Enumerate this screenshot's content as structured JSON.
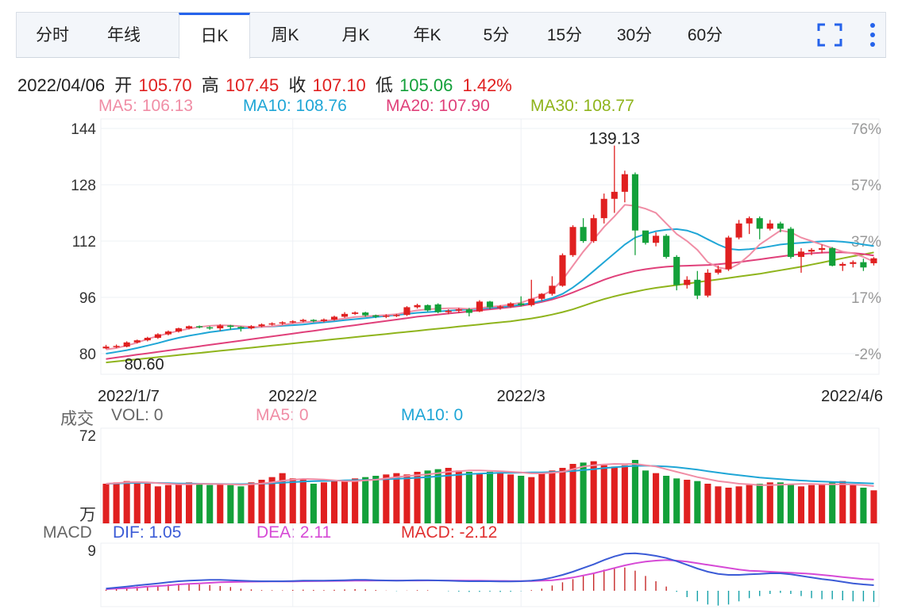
{
  "tabs": [
    {
      "label": "分时",
      "active": false
    },
    {
      "label": "年线",
      "active": false
    },
    {
      "label": "日K",
      "active": true
    },
    {
      "label": "周K",
      "active": false
    },
    {
      "label": "月K",
      "active": false
    },
    {
      "label": "年K",
      "active": false
    },
    {
      "label": "5分",
      "active": false
    },
    {
      "label": "15分",
      "active": false
    },
    {
      "label": "30分",
      "active": false
    },
    {
      "label": "60分",
      "active": false
    }
  ],
  "icons": {
    "fullscreen": "fullscreen-icon",
    "more": "more-vertical-icon"
  },
  "info": {
    "date": "2022/04/06",
    "open_label": "开",
    "open": "105.70",
    "high_label": "高",
    "high": "107.45",
    "close_label": "收",
    "close": "107.10",
    "low_label": "低",
    "low": "105.06",
    "change": "1.42%"
  },
  "ma_legend": [
    {
      "text": "MA5: 106.13",
      "color": "#f08da5"
    },
    {
      "text": "MA10: 108.76",
      "color": "#1fa6d6"
    },
    {
      "text": "MA20: 107.90",
      "color": "#e0407a"
    },
    {
      "text": "MA30: 108.77",
      "color": "#8fb41c"
    }
  ],
  "colors": {
    "up": "#e02020",
    "down": "#13a03a",
    "ma5": "#f08da5",
    "ma10": "#1fa6d6",
    "ma20": "#e0407a",
    "ma30": "#8fb41c",
    "dif": "#3b5bd6",
    "dea": "#d64ad6"
  },
  "chart_data": {
    "type": "candlestick",
    "y_ticks": [
      "144",
      "128",
      "112",
      "96",
      "80"
    ],
    "ylim": [
      80,
      144
    ],
    "pct_ticks": [
      "76%",
      "57%",
      "37%",
      "17%",
      "-2%"
    ],
    "x_ticks": [
      "2022/1/7",
      "2022/2",
      "2022/3",
      "2022/4/6"
    ],
    "max_label": "139.13",
    "min_label": "80.60",
    "candles": [
      [
        81.5,
        82,
        81.3,
        82.5
      ],
      [
        82,
        82.2,
        81.6,
        82.6
      ],
      [
        82,
        83.2,
        81.8,
        83.5
      ],
      [
        83.2,
        83.8,
        82.9,
        84
      ],
      [
        83.8,
        84.5,
        83.5,
        84.8
      ],
      [
        84.5,
        85.5,
        84.2,
        85.8
      ],
      [
        85.5,
        86.3,
        85.2,
        86.6
      ],
      [
        86.3,
        87.2,
        86,
        87.4
      ],
      [
        87.2,
        87.8,
        86.9,
        88
      ],
      [
        87.8,
        87.5,
        87.2,
        88
      ],
      [
        87.5,
        87.2,
        86.8,
        87.8
      ],
      [
        87.2,
        88,
        86.5,
        88.4
      ],
      [
        88,
        87.6,
        86.8,
        88.2
      ],
      [
        87.6,
        87.2,
        86.3,
        87.8
      ],
      [
        87.2,
        87.8,
        86.9,
        88.1
      ],
      [
        87.8,
        88.3,
        87.5,
        88.6
      ],
      [
        88.3,
        88.6,
        88,
        88.9
      ],
      [
        88.6,
        88.9,
        88.2,
        89.2
      ],
      [
        88.9,
        89.2,
        88.6,
        89.5
      ],
      [
        89.2,
        89.6,
        88.9,
        89.9
      ],
      [
        89.6,
        89.3,
        88.9,
        89.8
      ],
      [
        89.3,
        89.7,
        88.9,
        90
      ],
      [
        89.7,
        90.5,
        89.4,
        90.8
      ],
      [
        90.5,
        91.3,
        90.2,
        91.8
      ],
      [
        91.3,
        91.7,
        91,
        92
      ],
      [
        91.7,
        90.9,
        90.5,
        91.9
      ],
      [
        90.9,
        90.5,
        90.1,
        91.1
      ],
      [
        90.5,
        90.8,
        90.1,
        91.2
      ],
      [
        90.8,
        91,
        90.4,
        91.3
      ],
      [
        91,
        93.2,
        90.7,
        93.5
      ],
      [
        93.2,
        93.8,
        92.8,
        94.2
      ],
      [
        93.8,
        92.3,
        92,
        94
      ],
      [
        94,
        91.8,
        91.5,
        94.3
      ],
      [
        91.8,
        92.2,
        91.2,
        92.6
      ],
      [
        92.2,
        92.6,
        91.6,
        93
      ],
      [
        92.6,
        91.6,
        90.6,
        93
      ],
      [
        92,
        94.8,
        91.8,
        95.2
      ],
      [
        94.8,
        93.2,
        92.6,
        95
      ],
      [
        93.2,
        93.4,
        92.5,
        93.8
      ],
      [
        93.4,
        94.3,
        93,
        94.6
      ],
      [
        94.3,
        93.8,
        93.4,
        96.3
      ],
      [
        93.8,
        95.6,
        93.4,
        101
      ],
      [
        95.6,
        97,
        95,
        97.2
      ],
      [
        97,
        99.3,
        96.5,
        102
      ],
      [
        99.3,
        108,
        99,
        108.5
      ],
      [
        108,
        116,
        107.5,
        116.5
      ],
      [
        116,
        112,
        111.5,
        118.5
      ],
      [
        112,
        118.5,
        111.5,
        119.5
      ],
      [
        118.5,
        124,
        117,
        125.5
      ],
      [
        124,
        126,
        120,
        139.13
      ],
      [
        126,
        131,
        123,
        132
      ],
      [
        131,
        115,
        108,
        131.5
      ],
      [
        115,
        111.5,
        111,
        114
      ],
      [
        111.5,
        113.5,
        110.5,
        114.5
      ],
      [
        113.5,
        107.5,
        107,
        114
      ],
      [
        107.5,
        99.5,
        98,
        108
      ],
      [
        99.5,
        101,
        98.5,
        102
      ],
      [
        101,
        96.5,
        95.5,
        103.5
      ],
      [
        96.5,
        103,
        96,
        104
      ],
      [
        103,
        104,
        102.5,
        105
      ],
      [
        104,
        113,
        103.5,
        113.5
      ],
      [
        113,
        117,
        112.5,
        118
      ],
      [
        117,
        118.5,
        114,
        119
      ],
      [
        118.5,
        115.5,
        112.5,
        119
      ],
      [
        115.5,
        117,
        115,
        118
      ],
      [
        117,
        115.5,
        114.5,
        117.5
      ],
      [
        115.5,
        107.5,
        107,
        116
      ],
      [
        107.5,
        109,
        103,
        110
      ],
      [
        109,
        109.5,
        108,
        110
      ],
      [
        109.5,
        110,
        108.5,
        111
      ],
      [
        110,
        105,
        104.8,
        110.3
      ],
      [
        105,
        105.5,
        103.5,
        106
      ],
      [
        105.5,
        106,
        104.5,
        106.5
      ],
      [
        106,
        104.5,
        103.5,
        107
      ],
      [
        105.7,
        107.1,
        105.06,
        107.45
      ]
    ],
    "ma5": [
      81.2,
      81.6,
      82.3,
      83.1,
      84.2,
      85,
      85.8,
      86.5,
      87.1,
      87.6,
      87.9,
      88.1,
      88,
      87.8,
      87.6,
      87.6,
      87.8,
      88.2,
      88.6,
      88.9,
      89.1,
      89.3,
      89.6,
      90,
      90.4,
      90.6,
      90.8,
      91,
      91.2,
      91.8,
      92.3,
      92.6,
      92.8,
      92.9,
      92.9,
      92.7,
      93,
      93.3,
      93.6,
      94,
      94.5,
      95.5,
      96.5,
      98,
      101,
      105,
      109,
      112.5,
      116,
      119,
      122.3,
      122,
      121.2,
      120,
      117,
      114,
      112,
      109.5,
      106,
      104.5,
      104,
      105.5,
      108,
      111,
      113,
      115,
      114.5,
      113,
      112,
      111,
      110,
      109,
      108.5,
      107.5,
      106.13
    ],
    "ma10": [
      80,
      80.5,
      81,
      81.6,
      82.3,
      83,
      83.8,
      84.5,
      85.1,
      85.6,
      86.1,
      86.5,
      86.9,
      87.2,
      87.4,
      87.6,
      87.7,
      87.9,
      88.1,
      88.3,
      88.6,
      88.9,
      89.2,
      89.5,
      89.8,
      90.1,
      90.4,
      90.7,
      91,
      91.3,
      91.6,
      91.8,
      92,
      92.2,
      92.4,
      92.6,
      92.8,
      93,
      93.2,
      93.5,
      93.9,
      94.4,
      95,
      95.8,
      97,
      98.8,
      101,
      103.5,
      106,
      108.5,
      111,
      113,
      114,
      114.8,
      115.2,
      115.4,
      115,
      114,
      112.5,
      111,
      109.8,
      109.5,
      109.7,
      110,
      110.5,
      111,
      111.3,
      111.5,
      111.7,
      111.9,
      112,
      111.8,
      111.5,
      111,
      110.6
    ],
    "ma20": [
      78.5,
      78.9,
      79.3,
      79.7,
      80.1,
      80.5,
      80.9,
      81.3,
      81.7,
      82.1,
      82.5,
      82.9,
      83.3,
      83.7,
      84.1,
      84.5,
      84.9,
      85.3,
      85.7,
      86.1,
      86.5,
      86.9,
      87.3,
      87.7,
      88.1,
      88.5,
      88.9,
      89.3,
      89.7,
      90.1,
      90.5,
      90.8,
      91.1,
      91.4,
      91.7,
      92,
      92.3,
      92.6,
      92.9,
      93.2,
      93.6,
      94.1,
      94.7,
      95.4,
      96.3,
      97.4,
      98.6,
      99.8,
      101,
      102,
      102.8,
      103.5,
      104,
      104.4,
      104.7,
      104.9,
      105,
      105.1,
      105.2,
      105.4,
      105.7,
      106,
      106.4,
      106.8,
      107.2,
      107.6,
      108,
      108.3,
      108.5,
      108.7,
      108.8,
      108.8,
      108.6,
      108.3,
      107.9
    ],
    "ma30": [
      77.5,
      77.8,
      78.1,
      78.4,
      78.7,
      79,
      79.3,
      79.6,
      79.9,
      80.2,
      80.5,
      80.8,
      81.1,
      81.4,
      81.7,
      82,
      82.3,
      82.6,
      82.9,
      83.2,
      83.5,
      83.8,
      84.1,
      84.4,
      84.7,
      85,
      85.3,
      85.6,
      85.9,
      86.2,
      86.5,
      86.8,
      87.1,
      87.4,
      87.7,
      88,
      88.3,
      88.6,
      88.9,
      89.2,
      89.6,
      90,
      90.5,
      91.1,
      91.8,
      92.6,
      93.6,
      94.6,
      95.5,
      96.3,
      97,
      97.6,
      98.2,
      98.7,
      99.1,
      99.5,
      99.9,
      100.3,
      100.7,
      101.1,
      101.5,
      101.9,
      102.3,
      102.7,
      103.2,
      103.7,
      104.2,
      104.7,
      105.3,
      105.9,
      106.5,
      107.1,
      107.7,
      108.2,
      108.77
    ],
    "volume": {
      "legend": [
        {
          "text": "成交",
          "color": "#666"
        },
        {
          "text": "VOL: 0",
          "color": "#666"
        },
        {
          "text": "MA5: 0",
          "color": "#f08da5"
        },
        {
          "text": "MA10: 0",
          "color": "#1fa6d6"
        }
      ],
      "y_top": "72",
      "unit": "万",
      "ylim": [
        0,
        72
      ],
      "values": [
        30,
        31,
        32,
        31,
        30,
        28,
        29,
        30,
        31,
        30,
        29,
        30,
        29,
        28,
        31,
        33,
        35,
        38,
        34,
        33,
        30,
        31,
        32,
        33,
        34,
        35,
        36,
        37,
        38,
        37,
        39,
        40,
        41,
        42,
        40,
        39,
        38,
        39,
        38,
        37,
        36,
        35,
        38,
        40,
        42,
        45,
        46,
        47,
        44,
        43,
        44,
        48,
        40,
        38,
        36,
        34,
        33,
        32,
        30,
        28,
        27,
        28,
        29,
        30,
        31,
        31,
        30,
        28,
        29,
        30,
        31,
        32,
        29,
        27,
        25
      ],
      "ma5": [
        30,
        30.5,
        31,
        31.2,
        31,
        30.5,
        30,
        29.5,
        29.6,
        29.8,
        29.8,
        29.7,
        29.5,
        29.3,
        29.6,
        30.2,
        31,
        32.2,
        33,
        33.6,
        33.5,
        33.2,
        32.6,
        32,
        32,
        32.5,
        33,
        34,
        35,
        35.8,
        36.5,
        37,
        38,
        39,
        39.5,
        40,
        40,
        39.8,
        39.5,
        39,
        38.5,
        37.8,
        37.8,
        38.2,
        39,
        41,
        43,
        44,
        44.5,
        45,
        44.8,
        45,
        44,
        43,
        41,
        39,
        37,
        35,
        33.5,
        32,
        31,
        30,
        29.5,
        29,
        29,
        29.2,
        29.6,
        29.8,
        29.8,
        29.6,
        29.5,
        29.5,
        29.4,
        29,
        28.2
      ],
      "ma10": [
        30,
        30.2,
        30.4,
        30.6,
        30.7,
        30.6,
        30.4,
        30.2,
        30.1,
        30,
        29.9,
        29.8,
        29.7,
        29.7,
        29.8,
        30,
        30.3,
        30.7,
        31.2,
        31.6,
        31.9,
        32.1,
        32.3,
        32.5,
        32.7,
        32.9,
        33.1,
        33.4,
        33.7,
        34,
        34.5,
        35,
        35.6,
        36.2,
        36.8,
        37.3,
        37.7,
        38,
        38.2,
        38.3,
        38.4,
        38.5,
        38.6,
        38.8,
        39.1,
        39.6,
        40.3,
        41,
        41.8,
        42.5,
        43,
        43.5,
        43.6,
        43.4,
        43,
        42.4,
        41.6,
        40.6,
        39.5,
        38.4,
        37.4,
        36.4,
        35.5,
        34.7,
        34,
        33.4,
        32.9,
        32.4,
        32,
        31.6,
        31.3,
        31,
        30.7,
        30.4,
        30.1
      ]
    },
    "macd": {
      "legend": [
        {
          "text": "MACD",
          "color": "#666"
        },
        {
          "text": "DIF: 1.05",
          "color": "#3b5bd6"
        },
        {
          "text": "DEA: 2.11",
          "color": "#d64ad6"
        },
        {
          "text": "MACD: -2.12",
          "color": "#e03030"
        }
      ],
      "y_top": "9",
      "ylim": [
        -3,
        9
      ],
      "dif": [
        0.4,
        0.6,
        0.8,
        1.0,
        1.2,
        1.4,
        1.6,
        1.8,
        1.9,
        2.0,
        2.05,
        2.05,
        2.0,
        1.9,
        1.85,
        1.8,
        1.8,
        1.8,
        1.85,
        1.9,
        1.9,
        1.9,
        1.95,
        2.0,
        2.05,
        2.05,
        2.0,
        1.95,
        1.9,
        1.95,
        2.0,
        2.0,
        1.95,
        1.9,
        1.85,
        1.8,
        1.8,
        1.8,
        1.75,
        1.75,
        1.8,
        1.9,
        2.1,
        2.5,
        3.0,
        3.6,
        4.3,
        5.0,
        5.8,
        6.5,
        7.0,
        7.1,
        6.9,
        6.6,
        6.2,
        5.6,
        4.9,
        4.2,
        3.6,
        3.2,
        3.0,
        3.0,
        3.1,
        3.2,
        3.3,
        3.3,
        3.1,
        2.8,
        2.5,
        2.2,
        2.0,
        1.7,
        1.4,
        1.2,
        1.05
      ],
      "dea": [
        0.3,
        0.4,
        0.5,
        0.6,
        0.8,
        0.9,
        1.0,
        1.2,
        1.3,
        1.4,
        1.5,
        1.6,
        1.65,
        1.7,
        1.72,
        1.74,
        1.75,
        1.76,
        1.77,
        1.8,
        1.82,
        1.84,
        1.86,
        1.88,
        1.9,
        1.92,
        1.93,
        1.93,
        1.93,
        1.93,
        1.94,
        1.95,
        1.95,
        1.94,
        1.93,
        1.91,
        1.9,
        1.88,
        1.86,
        1.84,
        1.83,
        1.84,
        1.9,
        2.0,
        2.2,
        2.5,
        2.9,
        3.3,
        3.8,
        4.3,
        4.8,
        5.2,
        5.5,
        5.7,
        5.8,
        5.7,
        5.5,
        5.2,
        4.9,
        4.6,
        4.3,
        4.0,
        3.8,
        3.7,
        3.6,
        3.5,
        3.4,
        3.3,
        3.2,
        3.0,
        2.8,
        2.6,
        2.4,
        2.2,
        2.11
      ]
    }
  }
}
